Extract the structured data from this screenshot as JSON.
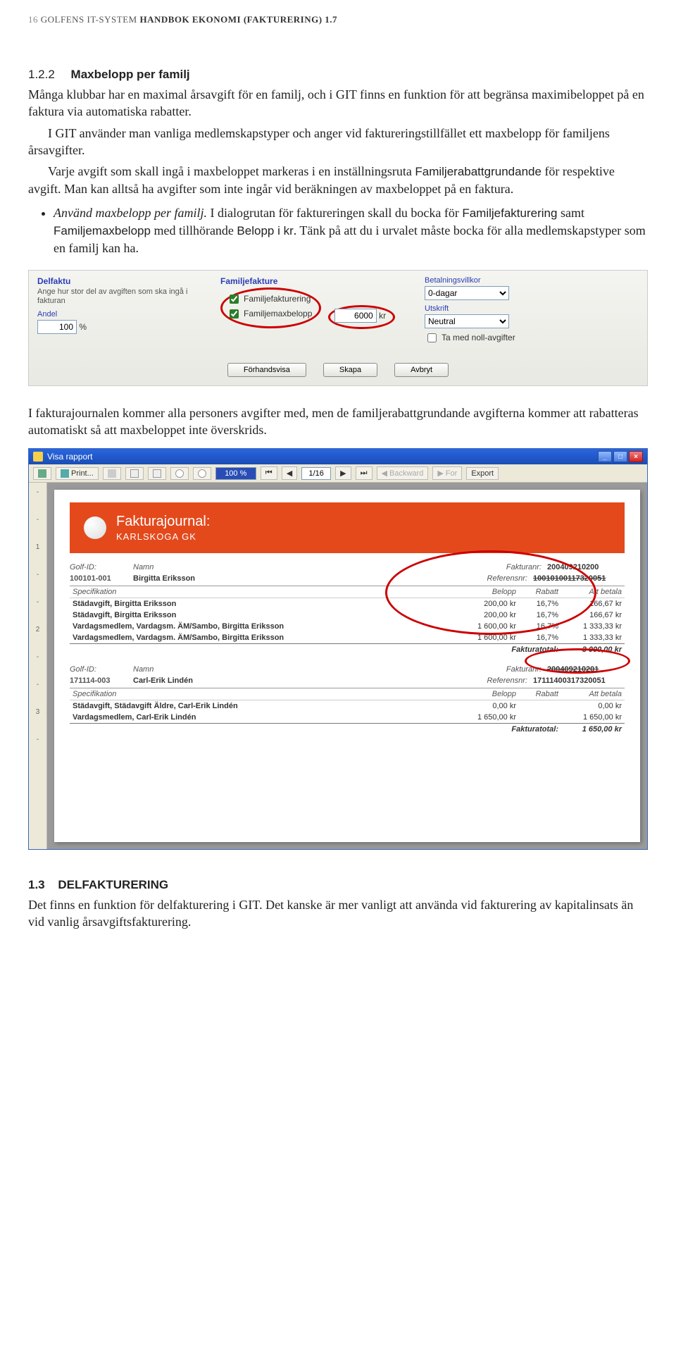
{
  "header": {
    "page_no": "16",
    "left": "GOLFENS IT-SYSTEM",
    "right": "HANDBOK EKONOMI (FAKTURERING) 1.7"
  },
  "section": {
    "num": "1.2.2",
    "title": "Maxbelopp per familj"
  },
  "para1": "Många klubbar har en maximal årsavgift för en familj, och i GIT finns en funktion för att begränsa maximibeloppet på en faktura via automatiska rabatter.",
  "para2": "I GIT använder man vanliga medlemskapstyper och anger vid faktureringstillfället ett maxbelopp för familjens årsavgifter.",
  "para3a": "Varje avgift som skall ingå i maxbeloppet markeras i en inställningsruta ",
  "para3b": "Familjerabattgrundande",
  "para3c": " för respektive avgift. Man kan alltså ha avgifter som inte ingår vid beräkningen av maxbeloppet på en faktura.",
  "bullet": {
    "lead_i": "Använd maxbelopp per familj.",
    "t1": " I dialogrutan för faktureringen skall du bocka för ",
    "w1": "Familjefakturering",
    "t2": " samt ",
    "w2": "Familjemaxbelopp",
    "t3": " med tillhörande ",
    "w3": "Belopp i kr",
    "t4": ". Tänk på att du i urvalet måste bocka för alla medlemskapstyper som en familj kan ha."
  },
  "form1": {
    "grp1": "Delfaktu",
    "hint1": "Ange hur stor del av avgiften som ska ingå i fakturan",
    "andel_lbl": "Andel",
    "andel_val": "100",
    "andel_unit": "%",
    "grp2": "Familjefakture",
    "chk1": "Familjefakturering",
    "chk2": "Familjemaxbelopp",
    "max_val": "6000",
    "max_unit": "kr",
    "bet_lbl": "Betalningsvillkor",
    "bet_val": "0-dagar",
    "uts_lbl": "Utskrift",
    "uts_val": "Neutral",
    "chk3": "Ta med noll-avgifter",
    "btn1": "Förhandsvisa",
    "btn2": "Skapa",
    "btn3": "Avbryt"
  },
  "para4": "I fakturajournalen kommer alla personers avgifter med, men de familjerabattgrundande avgifterna kommer att rabatteras automatiskt så att maxbeloppet inte överskrids.",
  "win": {
    "title": "Visa rapport",
    "print": "Print...",
    "zoom": "100 %",
    "page": "1/16",
    "back": "Backward",
    "fwd": "For",
    "export": "Export"
  },
  "report": {
    "banner_title": "Fakturajournal:",
    "banner_sub": "KARLSKOGA GK",
    "col_golfid": "Golf-ID:",
    "col_namn": "Namn",
    "col_fakturanr": "Fakturanr:",
    "col_referensnr": "Referensnr:",
    "col_spec": "Specifikation",
    "col_belopp": "Belopp",
    "col_rabatt": "Rabatt",
    "col_att": "Att betala",
    "tot_lbl": "Fakturatotal:",
    "rec1": {
      "golfid": "100101-001",
      "namn": "Birgitta Eriksson",
      "fakturanr": "200409210200",
      "referensnr": "10010100117320051",
      "rows": [
        {
          "spec": "Städavgift, Birgitta Eriksson",
          "belopp": "200,00 kr",
          "rabatt": "16,7%",
          "att": "166,67 kr"
        },
        {
          "spec": "Städavgift, Birgitta Eriksson",
          "belopp": "200,00 kr",
          "rabatt": "16,7%",
          "att": "166,67 kr"
        },
        {
          "spec": "Vardagsmedlem, Vardagsm. ÄM/Sambo, Birgitta Eriksson",
          "belopp": "1 600,00 kr",
          "rabatt": "16,7%",
          "att": "1 333,33 kr"
        },
        {
          "spec": "Vardagsmedlem, Vardagsm. ÄM/Sambo, Birgitta Eriksson",
          "belopp": "1 600,00 kr",
          "rabatt": "16,7%",
          "att": "1 333,33 kr"
        }
      ],
      "total": "3 000,00 kr"
    },
    "rec2": {
      "golfid": "171114-003",
      "namn": "Carl-Erik Lindén",
      "fakturanr": "200409210201",
      "referensnr": "17111400317320051",
      "rows": [
        {
          "spec": "Städavgift, Städavgift Äldre, Carl-Erik Lindén",
          "belopp": "0,00 kr",
          "rabatt": "",
          "att": "0,00 kr"
        },
        {
          "spec": "Vardagsmedlem, Carl-Erik Lindén",
          "belopp": "1 650,00 kr",
          "rabatt": "",
          "att": "1 650,00 kr"
        }
      ],
      "total": "1 650,00 kr"
    }
  },
  "section2": {
    "num": "1.3",
    "title": "DELFAKTURERING"
  },
  "para5": "Det finns en funktion för delfakturering i GIT. Det kanske är mer vanligt att använda vid fakturering av kapitalinsats än vid vanlig årsavgiftsfakturering."
}
